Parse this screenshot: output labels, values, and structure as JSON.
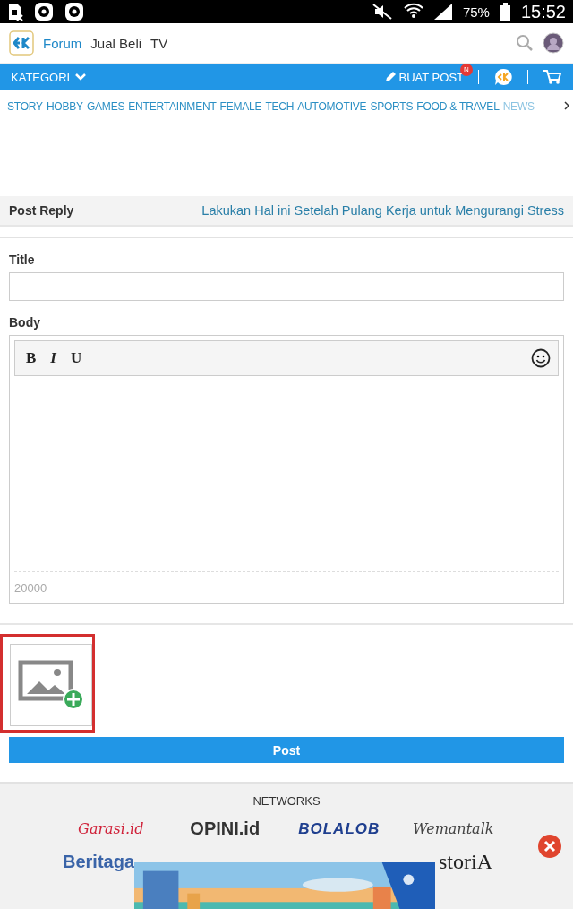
{
  "status_bar": {
    "battery": "75%",
    "time": "15:52"
  },
  "header": {
    "links": [
      {
        "label": "Forum",
        "selected": true
      },
      {
        "label": "Jual Beli",
        "selected": false
      },
      {
        "label": "TV",
        "selected": false
      }
    ]
  },
  "nav": {
    "menu": "KATEGORI",
    "create_post": "BUAT POST",
    "badge": "N"
  },
  "categories": [
    "STORY",
    "HOBBY",
    "GAMES",
    "ENTERTAINMENT",
    "FEMALE",
    "TECH",
    "AUTOMOTIVE",
    "SPORTS",
    "FOOD & TRAVEL",
    "NEWS"
  ],
  "post_reply": {
    "heading": "Post Reply",
    "thread_title": "Lakukan Hal ini Setelah Pulang Kerja untuk Mengurangi Stress"
  },
  "form": {
    "title_label": "Title",
    "body_label": "Body",
    "toolbar": [
      {
        "label": "B",
        "kind": "bold"
      },
      {
        "label": "I",
        "kind": "italic"
      },
      {
        "label": "U",
        "kind": "underline"
      }
    ],
    "char_count": "20000",
    "post_button": "Post"
  },
  "networks": {
    "heading": "NETWORKS",
    "logos": [
      {
        "label": "Garasi.id",
        "color": "#d0223a",
        "kind": "script"
      },
      {
        "label": "OPINI.id",
        "color": "#333333",
        "kind": "block"
      },
      {
        "label": "BOLALOB",
        "color": "#1f3f8f",
        "kind": "wide"
      },
      {
        "label": "Wemantalk",
        "color": "#444444",
        "kind": "script"
      },
      {
        "label": "Beritaga",
        "color": "#3a64a8",
        "kind": "block"
      },
      {
        "label": "storiA",
        "color": "#222222",
        "kind": "serif"
      }
    ]
  }
}
